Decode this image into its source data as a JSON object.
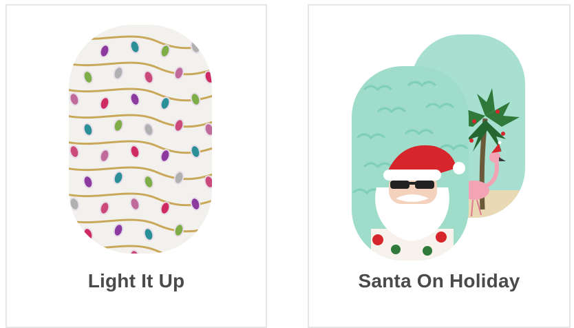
{
  "products": [
    {
      "name": "Light It Up",
      "image": "string-lights-nail-wrap"
    },
    {
      "name": "Santa On Holiday",
      "image": "santa-beach-nail-wrap"
    }
  ],
  "colors": {
    "card_border": "#e6e6e6",
    "title_text": "#4a4a4a",
    "wrap_white": "#f3f1ee",
    "wrap_mint": "#9fdcca",
    "wire_gold": "#c9a85a",
    "santa_red": "#d6262b"
  }
}
